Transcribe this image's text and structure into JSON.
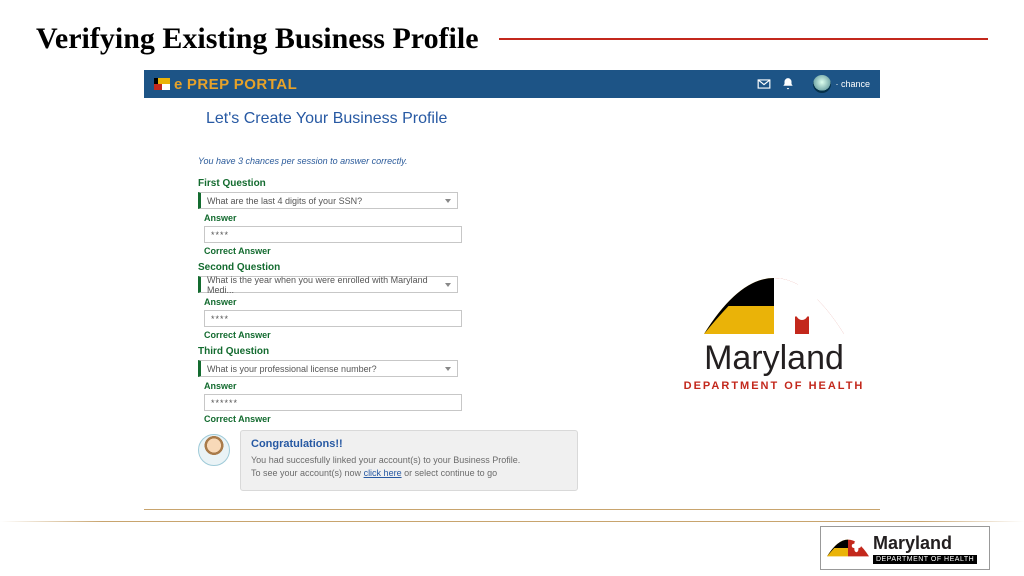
{
  "slide": {
    "title": "Verifying Existing Business Profile"
  },
  "portalBar": {
    "brand_e": "e",
    "brand_prep": "PREP",
    "brand_portal": " PORTAL",
    "username": "· chance"
  },
  "page": {
    "heading": "Let's Create Your Business Profile",
    "hint": "You have 3 chances per session to answer correctly."
  },
  "q1": {
    "label": "First Question",
    "select": "What are the last 4 digits of your SSN?",
    "answer_label": "Answer",
    "input": "****",
    "correct": "Correct Answer"
  },
  "q2": {
    "label": "Second Question",
    "select": "What is the year when you were enrolled with Maryland Medi...",
    "answer_label": "Answer",
    "input": "****",
    "correct": "Correct Answer"
  },
  "q3": {
    "label": "Third Question",
    "select": "What is your professional license number?",
    "answer_label": "Answer",
    "input": "******",
    "correct": "Correct Answer"
  },
  "congrats": {
    "title": "Congratulations!!",
    "line1": "You had succesfully linked your account(s) to your Business Profile.",
    "line2_a": "To see your account(s) now ",
    "link": "click here",
    "line2_b": " or select continue to go"
  },
  "mdh": {
    "word": "Maryland",
    "sub": "DEPARTMENT OF HEALTH"
  },
  "footer": {
    "word": "Maryland",
    "sub": "DEPARTMENT OF HEALTH"
  }
}
